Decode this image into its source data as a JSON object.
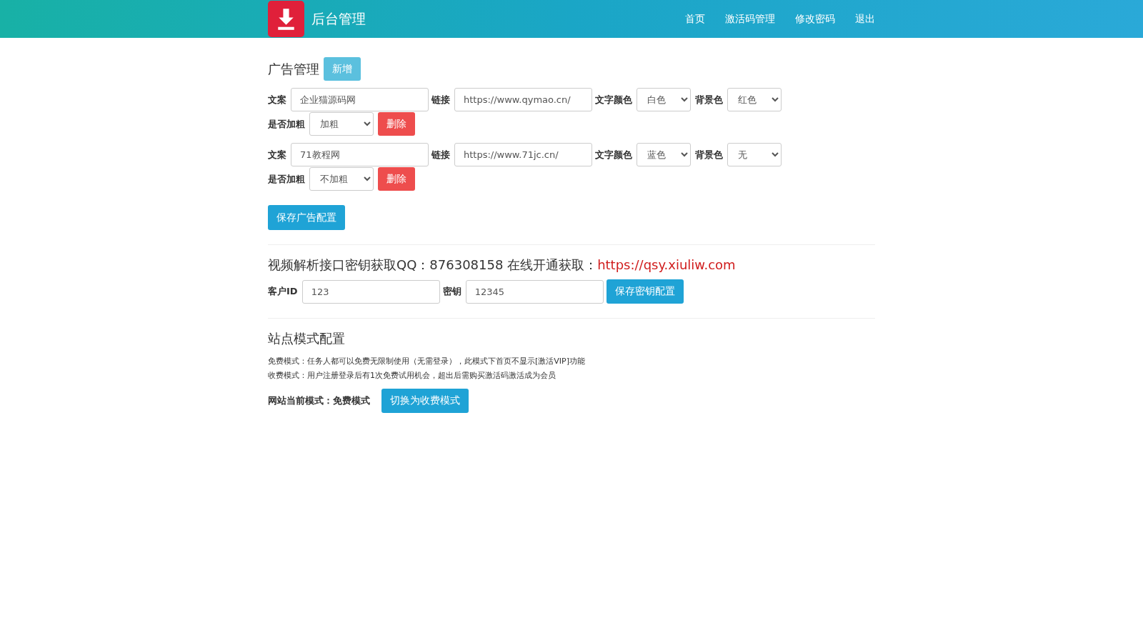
{
  "header": {
    "title": "后台管理",
    "nav": [
      {
        "label": "首页"
      },
      {
        "label": "激活码管理"
      },
      {
        "label": "修改密码"
      },
      {
        "label": "退出"
      }
    ]
  },
  "ads": {
    "title": "广告管理",
    "add_button": "新增",
    "items": [
      {
        "text_label": "文案",
        "text": "企业猫源码网",
        "link_label": "链接",
        "link": "https://www.qymao.cn/",
        "color_label": "文字颜色",
        "text_color": "白色",
        "bg_label": "背景色",
        "bg": "红色",
        "bold_label": "是否加粗",
        "bold": "加粗",
        "delete_button": "删除"
      },
      {
        "text_label": "文案",
        "text": "71教程网",
        "link_label": "链接",
        "link": "https://www.71jc.cn/",
        "color_label": "文字颜色",
        "text_color": "蓝色",
        "bg_label": "背景色",
        "bg": "无",
        "bold_label": "是否加粗",
        "bold": "不加粗",
        "delete_button": "删除"
      }
    ],
    "save_button": "保存广告配置"
  },
  "api": {
    "title": "视频解析接口密钥获取QQ：876308158 在线开通获取：",
    "link": "https://qsy.xiuliw.com",
    "id_label": "客户ID",
    "id": "123",
    "key_label": "密钥",
    "key": "12345",
    "save_button": "保存密钥配置"
  },
  "mode": {
    "title": "站点模式配置",
    "notes": [
      "免费模式：任务人都可以免费无限制使用（无需登录），此模式下首页不显示[激活VIP]功能",
      "收费模式：用户注册登录后有1次免费试用机会，超出后需购买激活码激活成为会员"
    ],
    "current": "网站当前模式：免费模式",
    "switch_button": "切换为收费模式"
  }
}
